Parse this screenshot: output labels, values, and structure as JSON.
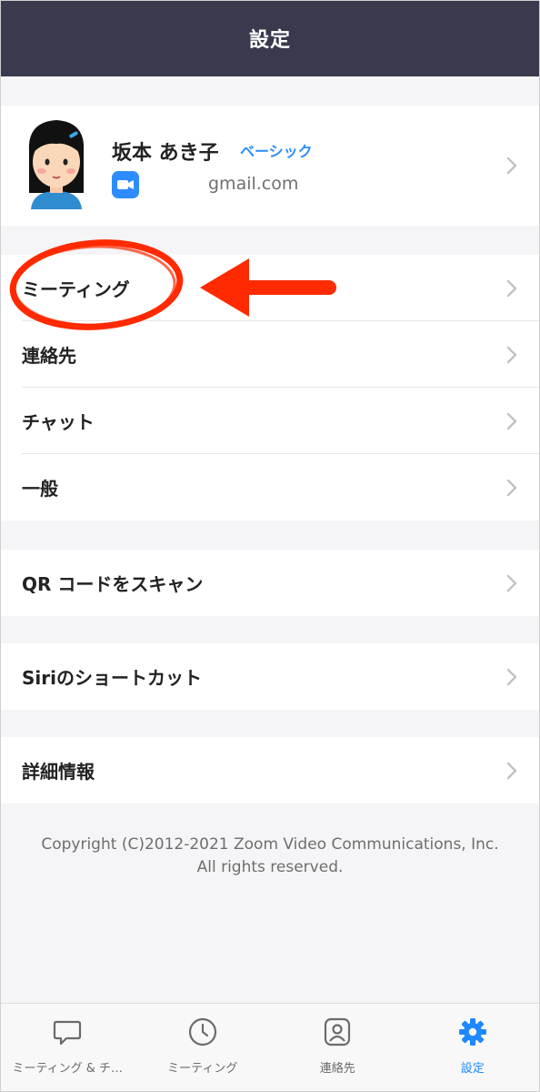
{
  "header": {
    "title": "設定"
  },
  "profile": {
    "name": "坂本 あき子",
    "plan": "ベーシック",
    "email": "gmail.com"
  },
  "menu": [
    {
      "label": "ミーティング"
    },
    {
      "label": "連絡先"
    },
    {
      "label": "チャット"
    },
    {
      "label": "一般"
    },
    {
      "label": "QR コードをスキャン"
    },
    {
      "label": "Siriのショートカット"
    },
    {
      "label": "詳細情報"
    }
  ],
  "copyright": {
    "line1": "Copyright (C)2012-2021 Zoom Video Communications, Inc.",
    "line2": "All rights reserved."
  },
  "tabbar": {
    "items": [
      {
        "label": "ミーティング & チ…",
        "icon": "chat-bubble-icon"
      },
      {
        "label": "ミーティング",
        "icon": "clock-icon"
      },
      {
        "label": "連絡先",
        "icon": "contact-icon"
      },
      {
        "label": "設定",
        "icon": "gear-icon"
      }
    ]
  },
  "colors": {
    "header_bg": "#393a4e",
    "accent": "#2d8cff",
    "annotation": "#ff2a00"
  }
}
